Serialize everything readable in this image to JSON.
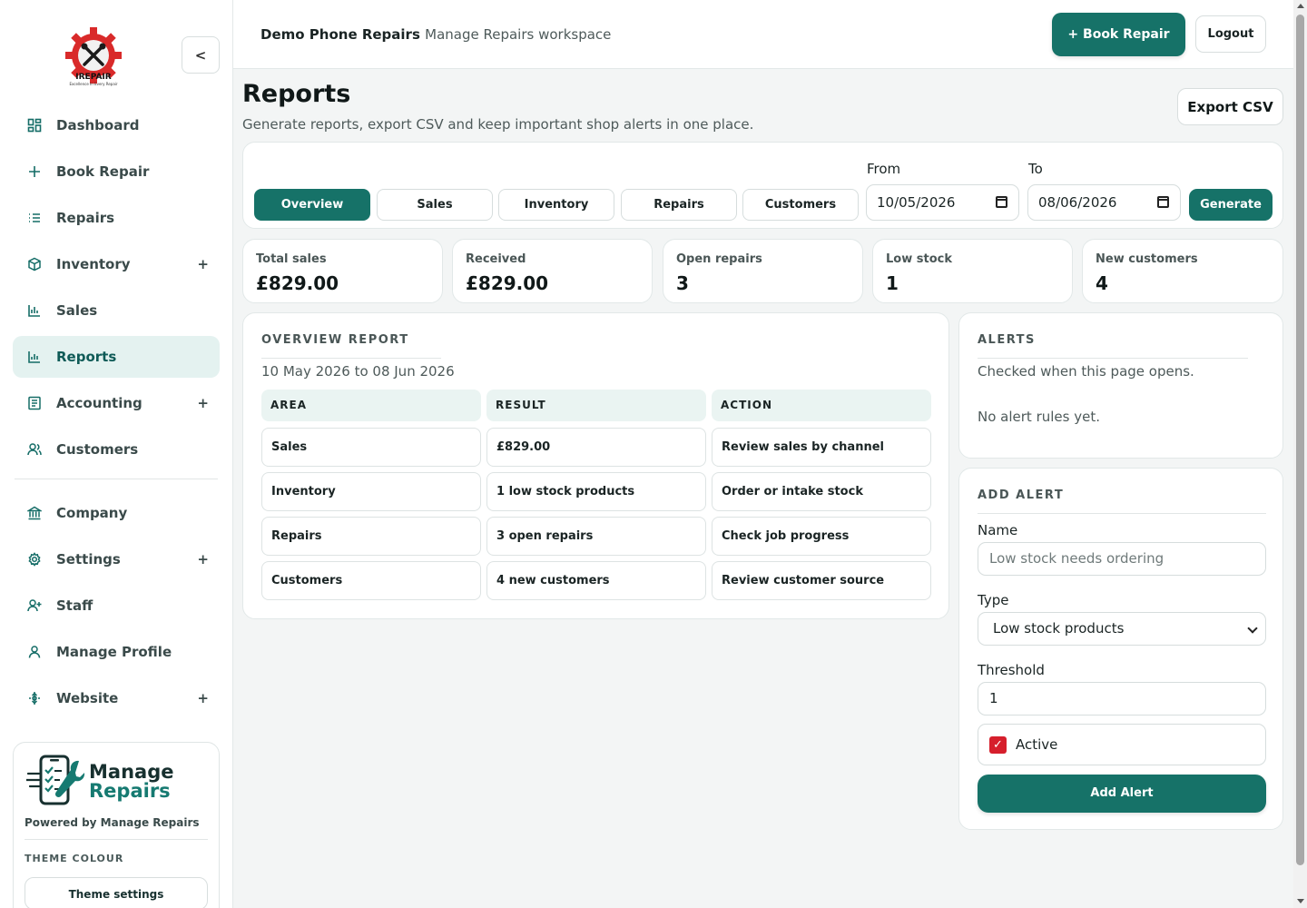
{
  "colors": {
    "accent": "#167268",
    "active_nav_bg": "#e4f2f0",
    "checkbox": "#d61f2c"
  },
  "sidebar": {
    "logo_text": "IREPAIR",
    "logo_sub": "Excellence In Every Repair",
    "collapse_label": "<",
    "items": [
      {
        "label": "Dashboard",
        "icon": "dashboard-icon",
        "expandable": false
      },
      {
        "label": "Book Repair",
        "icon": "plus-icon",
        "expandable": false
      },
      {
        "label": "Repairs",
        "icon": "list-icon",
        "expandable": false
      },
      {
        "label": "Inventory",
        "icon": "box-icon",
        "expandable": true
      },
      {
        "label": "Sales",
        "icon": "bar-chart-icon",
        "expandable": false
      },
      {
        "label": "Reports",
        "icon": "report-chart-icon",
        "expandable": false,
        "active": true
      },
      {
        "label": "Accounting",
        "icon": "ledger-icon",
        "expandable": true
      },
      {
        "label": "Customers",
        "icon": "users-icon",
        "expandable": false
      },
      {
        "label": "Company",
        "icon": "bank-icon",
        "expandable": false
      },
      {
        "label": "Settings",
        "icon": "gear-icon",
        "expandable": true
      },
      {
        "label": "Staff",
        "icon": "user-plus-icon",
        "expandable": false
      },
      {
        "label": "Manage Profile",
        "icon": "user-icon",
        "expandable": false
      },
      {
        "label": "Website",
        "icon": "website-icon",
        "expandable": true
      }
    ],
    "expand_symbol": "+",
    "brand": {
      "name_line1": "Manage",
      "name_line2": "Repairs",
      "powered_by": "Powered by Manage Repairs",
      "theme_label": "THEME COLOUR",
      "theme_button": "Theme settings"
    }
  },
  "topbar": {
    "shop_name": "Demo Phone Repairs",
    "workspace": "Manage Repairs workspace",
    "book_repair": "+ Book Repair",
    "logout": "Logout"
  },
  "page": {
    "title": "Reports",
    "subtitle": "Generate reports, export CSV and keep important shop alerts in one place.",
    "export_csv": "Export CSV"
  },
  "filters": {
    "tabs": [
      "Overview",
      "Sales",
      "Inventory",
      "Repairs",
      "Customers"
    ],
    "active_tab": "Overview",
    "from_label": "From",
    "from_value": "10/05/2026",
    "to_label": "To",
    "to_value": "08/06/2026",
    "generate": "Generate"
  },
  "stats": [
    {
      "label": "Total sales",
      "value": "£829.00"
    },
    {
      "label": "Received",
      "value": "£829.00"
    },
    {
      "label": "Open repairs",
      "value": "3"
    },
    {
      "label": "Low stock",
      "value": "1"
    },
    {
      "label": "New customers",
      "value": "4"
    }
  ],
  "overview": {
    "title": "OVERVIEW REPORT",
    "range": "10 May 2026 to 08 Jun 2026",
    "headers": [
      "AREA",
      "RESULT",
      "ACTION"
    ],
    "rows": [
      [
        "Sales",
        "£829.00",
        "Review sales by channel"
      ],
      [
        "Inventory",
        "1 low stock products",
        "Order or intake stock"
      ],
      [
        "Repairs",
        "3 open repairs",
        "Check job progress"
      ],
      [
        "Customers",
        "4 new customers",
        "Review customer source"
      ]
    ]
  },
  "alerts": {
    "title": "ALERTS",
    "checked": "Checked when this page opens.",
    "empty": "No alert rules yet."
  },
  "add_alert": {
    "title": "ADD ALERT",
    "name_label": "Name",
    "name_placeholder": "Low stock needs ordering",
    "type_label": "Type",
    "type_value": "Low stock products",
    "threshold_label": "Threshold",
    "threshold_value": "1",
    "active_label": "Active",
    "active_checked": true,
    "submit": "Add Alert"
  }
}
